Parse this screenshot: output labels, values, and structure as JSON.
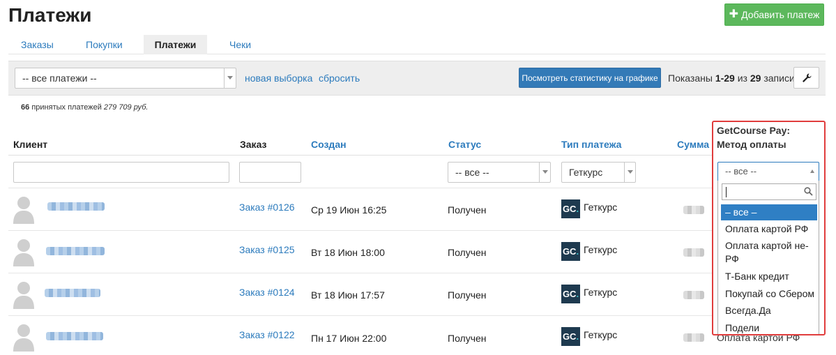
{
  "page": {
    "title": "Платежи",
    "add_button_label": "Добавить платеж"
  },
  "tabs": [
    {
      "label": "Заказы"
    },
    {
      "label": "Покупки"
    },
    {
      "label": "Платежи"
    },
    {
      "label": "Чеки"
    }
  ],
  "filters": {
    "selection_value": "-- все платежи --",
    "new_selection_label": "новая выборка",
    "reset_label": "сбросить",
    "stats_button_label": "Посмотреть статистику на графике",
    "shown_prefix": "Показаны",
    "shown_range": "1-29",
    "shown_middle": "из",
    "shown_total": "29",
    "shown_suffix": "записи."
  },
  "summary": {
    "count": "66",
    "text": "принятых платежей",
    "amount": "279 709 руб."
  },
  "columns": {
    "client": "Клиент",
    "order": "Заказ",
    "created": "Создан",
    "status": "Статус",
    "payment_type": "Тип платежа",
    "sum": "Сумма",
    "gc_pay_method": "GetCourse Pay: Метод оплаты"
  },
  "column_filters": {
    "status_value": "-- все --",
    "type_value": "Геткурс",
    "method_value": "-- все --"
  },
  "rows": [
    {
      "order": "Заказ #0126",
      "created": "Ср 19 Июн 16:25",
      "status": "Получен",
      "type": "Геткурс"
    },
    {
      "order": "Заказ #0125",
      "created": "Вт 18 Июн 18:00",
      "status": "Получен",
      "type": "Геткурс"
    },
    {
      "order": "Заказ #0124",
      "created": "Вт 18 Июн 17:57",
      "status": "Получен",
      "type": "Геткурс"
    },
    {
      "order": "Заказ #0122",
      "created": "Пн 17 Июн 22:00",
      "status": "Получен",
      "type": "Геткурс"
    }
  ],
  "logo_text": {
    "gc": "GC",
    "dot": "."
  },
  "dropdown_options": [
    "– все –",
    "Оплата картой РФ",
    "Оплата картой не-РФ",
    "Т-Банк кредит",
    "Покупай со Сбером",
    "Всегда.Да",
    "Подели"
  ],
  "below_dropdown_text": "Оплата картой РФ",
  "colors": {
    "accent_link": "#2c7bbd",
    "add_button": "#5cb85c",
    "primary_button": "#337ab7",
    "highlight": "#e03c3c",
    "selected_option": "#2f7fc4"
  },
  "icons": {
    "add": "plus-icon",
    "settings": "wrench-icon",
    "search": "search-icon",
    "avatar": "user-silhouette-icon",
    "logo": "getcourse-logo-icon"
  }
}
